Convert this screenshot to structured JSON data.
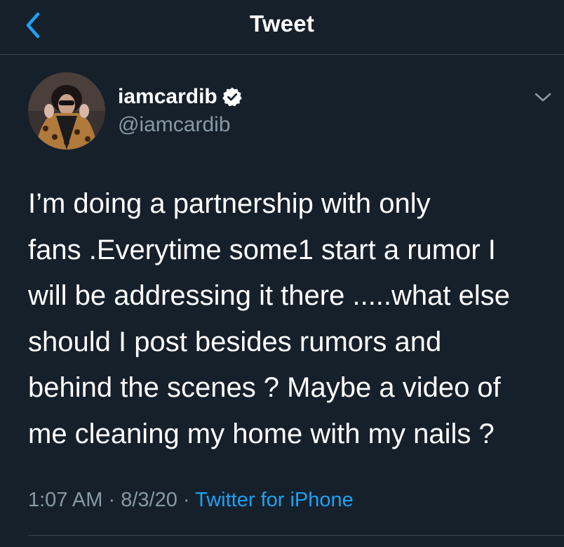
{
  "header": {
    "title": "Tweet",
    "back_icon": "chevron-left-icon"
  },
  "author": {
    "display_name": "iamcardib",
    "handle": "@iamcardib",
    "verified": true,
    "verified_icon": "verified-badge-icon"
  },
  "tweet": {
    "text": "I’m doing a partnership with only\nfans .Everytime some1 start a rumor I\nwill be addressing it there .....what else\nshould I post besides rumors and\nbehind the scenes ? Maybe a video of\nme cleaning my home  with my nails ?",
    "time": "1:07 AM",
    "date": "8/3/20",
    "source": "Twitter for iPhone",
    "separator": "·"
  },
  "colors": {
    "background": "#15202b",
    "divider": "#38444d",
    "accent": "#1da1f2",
    "secondary_text": "#8899a6"
  }
}
